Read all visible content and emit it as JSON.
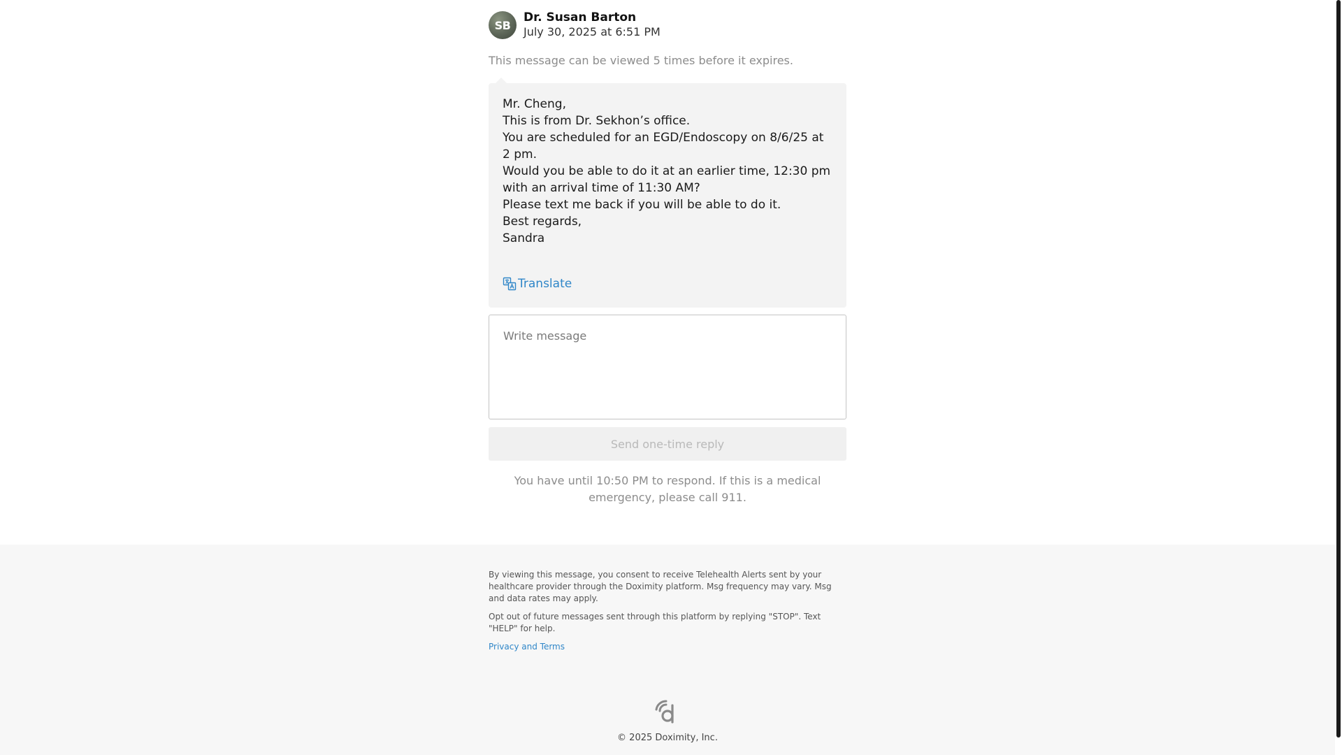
{
  "sender": {
    "initials": "SB",
    "name": "Dr. Susan Barton",
    "timestamp": "July 30, 2025 at 6:51 PM"
  },
  "view_notice": "This message can be viewed 5 times before it expires.",
  "message": {
    "lines": [
      "Mr. Cheng,",
      "This is from Dr. Sekhon’s office.",
      "You are scheduled for an EGD/Endoscopy on 8/6/25 at 2 pm.",
      "Would you be able to do it at an earlier time, 12:30 pm with an arrival time of 11:30 AM?",
      "Please text me back if you will be able to do it.",
      "Best regards,",
      "Sandra"
    ],
    "translate_label": "Translate",
    "translate_icon": "translate-icon"
  },
  "reply": {
    "placeholder": "Write message",
    "value": "",
    "send_label": "Send one-time reply",
    "deadline_text": "You have until 10:50 PM to respond. If this is a medical emergency, please call 911."
  },
  "footer": {
    "consent_text": "By viewing this message, you consent to receive Telehealth Alerts sent by your healthcare provider through the Doximity platform. Msg frequency may vary. Msg and data rates may apply.",
    "opt_out_text": "Opt out of future messages sent through this platform by replying \"STOP\". Text \"HELP\" for help.",
    "privacy_label": "Privacy and Terms",
    "logo_icon": "doximity-logo-icon",
    "copyright": "© 2025 Doximity, Inc."
  },
  "colors": {
    "link": "#2f86c8",
    "bubble_bg": "#f3f3f3",
    "footer_bg": "#f7f7f7",
    "muted_text": "#8c8c8c"
  }
}
